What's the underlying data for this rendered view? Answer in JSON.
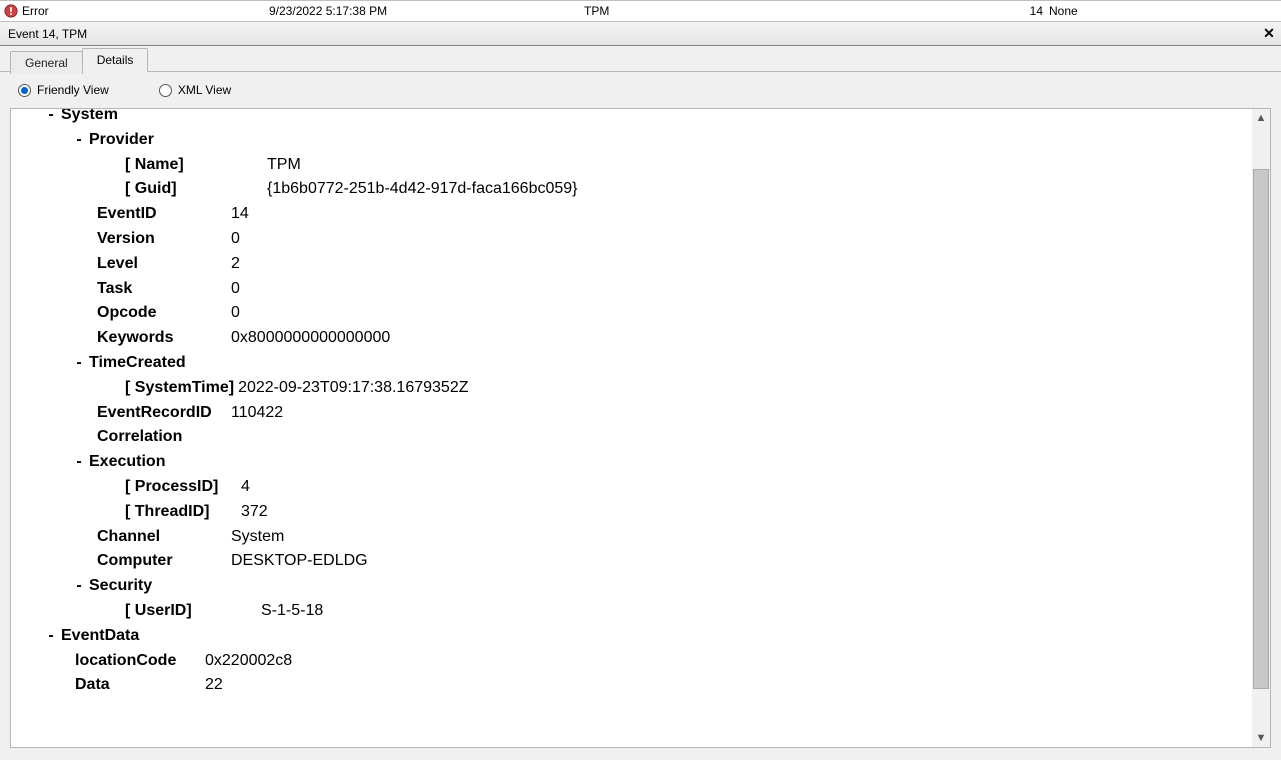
{
  "log_row": {
    "level": "Error",
    "date": "9/23/2022 5:17:38 PM",
    "source": "TPM",
    "event_id": "14",
    "category": "None"
  },
  "panel_title": "Event 14, TPM",
  "tabs": {
    "general": "General",
    "details": "Details"
  },
  "views": {
    "friendly": "Friendly View",
    "xml": "XML View"
  },
  "system_label": "System",
  "provider": {
    "label": "Provider",
    "name_k": "[ Name]",
    "name_v": "TPM",
    "guid_k": "[ Guid]",
    "guid_v": "{1b6b0772-251b-4d42-917d-faca166bc059}"
  },
  "event_id": {
    "k": "EventID",
    "v": "14"
  },
  "version": {
    "k": "Version",
    "v": "0"
  },
  "level": {
    "k": "Level",
    "v": "2"
  },
  "task": {
    "k": "Task",
    "v": "0"
  },
  "opcode": {
    "k": "Opcode",
    "v": "0"
  },
  "keywords": {
    "k": "Keywords",
    "v": "0x8000000000000000"
  },
  "time_created": {
    "label": "TimeCreated",
    "systime_k": "[ SystemTime]",
    "systime_v": "2022-09-23T09:17:38.1679352Z"
  },
  "record_id": {
    "k": "EventRecordID",
    "v": "110422"
  },
  "correlation": {
    "k": "Correlation"
  },
  "execution": {
    "label": "Execution",
    "pid_k": "[ ProcessID]",
    "pid_v": "4",
    "tid_k": "[ ThreadID]",
    "tid_v": "372"
  },
  "channel": {
    "k": "Channel",
    "v": "System"
  },
  "computer": {
    "k": "Computer",
    "v": "DESKTOP-EDLDG"
  },
  "security": {
    "label": "Security",
    "uid_k": "[ UserID]",
    "uid_v": "S-1-5-18"
  },
  "eventdata": {
    "label": "EventData",
    "loc_k": "locationCode",
    "loc_v": "0x220002c8",
    "data_k": "Data",
    "data_v": "22"
  }
}
